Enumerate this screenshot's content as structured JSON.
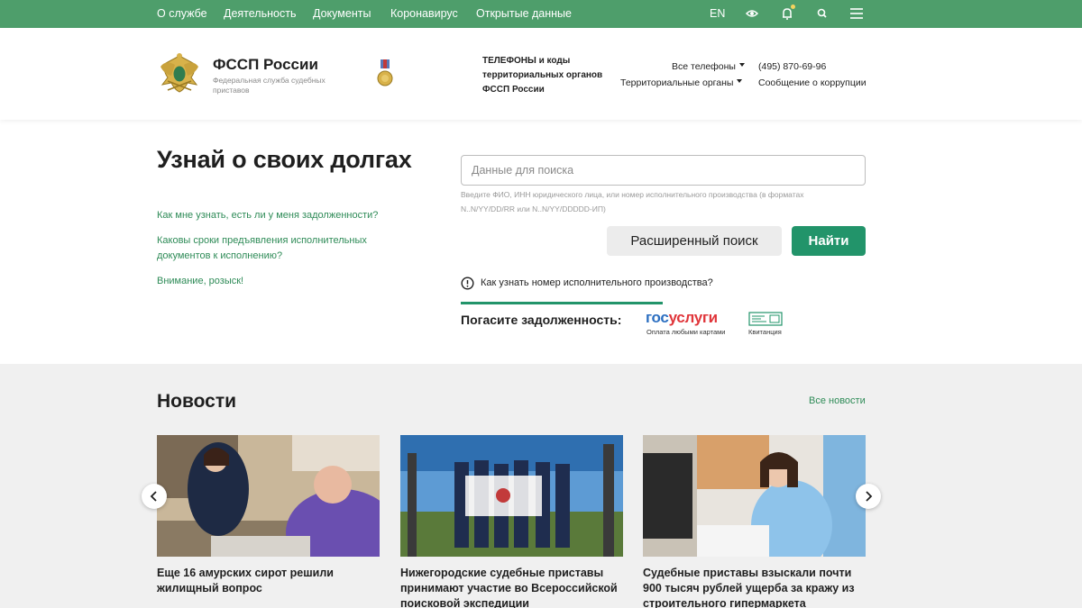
{
  "topnav": {
    "links": [
      "О службе",
      "Деятельность",
      "Документы",
      "Коронавирус",
      "Открытые данные"
    ],
    "lang": "EN"
  },
  "header": {
    "brand_title": "ФССП России",
    "brand_subtitle": "Федеральная служба судебных приставов",
    "phones_title": "ТЕЛЕФОНЫ и коды территориальных органов ФССП России",
    "all_phones": "Все телефоны",
    "territorial": "Территориальные органы",
    "phone": "(495) 870-69-96",
    "corruption": "Сообщение о коррупции"
  },
  "hero": {
    "title": "Узнай о своих долгах",
    "side_links": [
      "Как мне узнать, есть ли у меня задолженности?",
      "Каковы сроки предъявления исполнительных документов к исполнению?",
      "Внимание, розыск!"
    ],
    "search_placeholder": "Данные для поиска",
    "search_hint": "Введите ФИО, ИНН юридического лица, или номер исполнительного производства (в форматах N..N/YY/DD/RR или N..N/YY/DDDDD-ИП)",
    "advanced_search": "Расширенный поиск",
    "find": "Найти",
    "info_link": "Как узнать номер исполнительного производства?",
    "pay_label": "Погасите задолженность:",
    "gosu_part1": "гос",
    "gosu_part2": "услуги",
    "gosu_sub": "Оплата любыми картами",
    "receipt_sub": "Квитанция"
  },
  "news": {
    "title": "Новости",
    "all_news": "Все новости",
    "cards": [
      {
        "title": "Еще 16 амурских сирот решили жилищный вопрос"
      },
      {
        "title": "Нижегородские судебные приставы принимают участие во Всероссийской поисковой экспедиции"
      },
      {
        "title": "Судебные приставы взыскали почти 900 тысяч рублей ущерба за кражу из строительного гипермаркета"
      }
    ]
  },
  "colors": {
    "topbar": "#4e9e6b",
    "accent": "#22946a",
    "link": "#2e8b57"
  }
}
